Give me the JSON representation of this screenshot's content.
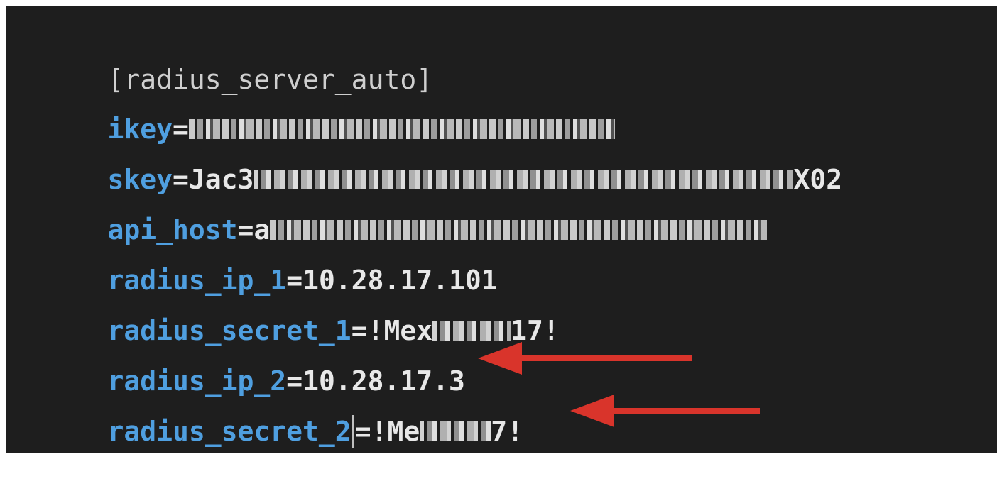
{
  "editor": {
    "section_header": "[radius_server_auto]",
    "lines": [
      {
        "key": "ikey",
        "sep": "=",
        "value_prefix": "",
        "value_suffix": ""
      },
      {
        "key": "skey",
        "sep": "=",
        "value_prefix": "Jac3",
        "value_suffix": "X02"
      },
      {
        "key": "api_host",
        "sep": "=",
        "value_prefix": "a",
        "value_suffix": ""
      },
      {
        "key": "radius_ip_1",
        "sep": "=",
        "value_prefix": "10.28.17.101",
        "value_suffix": ""
      },
      {
        "key": "radius_secret_1",
        "sep": "=",
        "value_prefix": "!Mex",
        "value_suffix": "17!"
      },
      {
        "key": "radius_ip_2",
        "sep": "=",
        "value_prefix": "10.28.17.3",
        "value_suffix": ""
      },
      {
        "key": "radius_secret_2",
        "sep": "=",
        "value_prefix": "!Me",
        "value_suffix": "7!"
      }
    ]
  },
  "colors": {
    "background": "#1e1e1e",
    "key": "#4f9fe0",
    "value": "#e8e8e8",
    "arrow": "#d9342b"
  },
  "annotations": {
    "arrow_icon": "red-left-arrow-icon"
  }
}
